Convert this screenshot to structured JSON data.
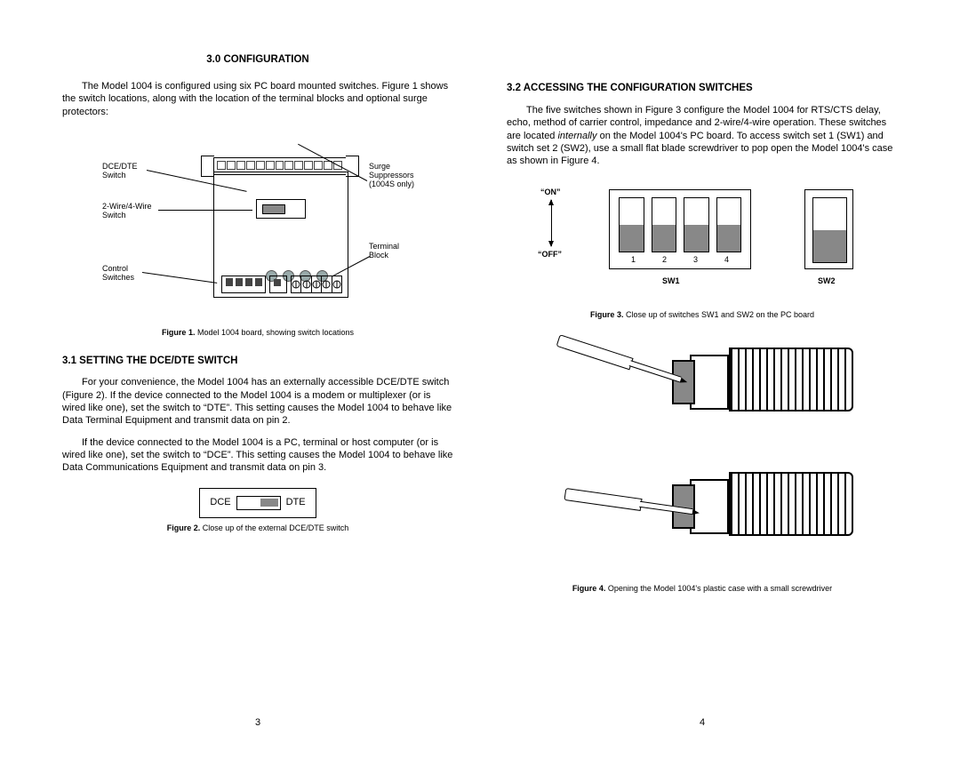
{
  "left": {
    "h1": "3.0 CONFIGURATION",
    "p1": "The Model 1004 is configured using six PC board mounted switches. Figure 1 shows the switch locations, along with the location of the terminal blocks and optional surge protectors:",
    "fig1": {
      "label_dcedte": "DCE/DTE\nSwitch",
      "label_2wire": "2-Wire/4-Wire\nSwitch",
      "label_control": "Control\nSwitches",
      "label_surge": "Surge\nSuppressors\n(1004S only)",
      "label_terminal": "Terminal\nBlock",
      "caption_b": "Figure 1.",
      "caption": "  Model 1004 board, showing switch locations"
    },
    "h2": "3.1 SETTING THE DCE/DTE SWITCH",
    "p2": "For your convenience, the Model 1004 has an externally accessible DCE/DTE switch (Figure 2). If the device connected to the Model 1004 is a modem or multiplexer (or is wired like one), set the switch to “DTE”. This setting causes the Model 1004 to behave like Data Terminal Equipment and transmit data on pin 2.",
    "p3": "If the device connected to the Model 1004 is a PC, terminal or host computer (or is wired like one), set the switch to “DCE”. This setting causes the Model 1004 to behave like Data Communications Equipment and transmit data on pin 3.",
    "fig2": {
      "dce": "DCE",
      "dte": "DTE",
      "caption_b": "Figure 2.",
      "caption": "  Close up of the external DCE/DTE switch"
    },
    "pagenum": "3"
  },
  "right": {
    "h2": "3.2 ACCESSING THE CONFIGURATION SWITCHES",
    "p1_a": "The five switches shown in Figure 3 configure the Model 1004 for RTS/CTS delay, echo, method of carrier control, impedance and 2-wire/4-wire operation. These switches are located ",
    "p1_i": "internally",
    "p1_b": " on the Model 1004's PC board. To access switch set 1 (SW1) and switch set 2 (SW2), use a small flat blade screwdriver to pop open the Model 1004's case as shown in Figure 4.",
    "fig3": {
      "on": "“ON”",
      "off": "“OFF”",
      "n1": "1",
      "n2": "2",
      "n3": "3",
      "n4": "4",
      "sw1": "SW1",
      "sw2": "SW2",
      "caption_b": "Figure 3.",
      "caption": "  Close up of switches SW1 and SW2 on the PC board"
    },
    "fig4": {
      "caption_b": "Figure 4.",
      "caption": "  Opening the Model 1004's plastic case with a small screwdriver"
    },
    "pagenum": "4"
  }
}
